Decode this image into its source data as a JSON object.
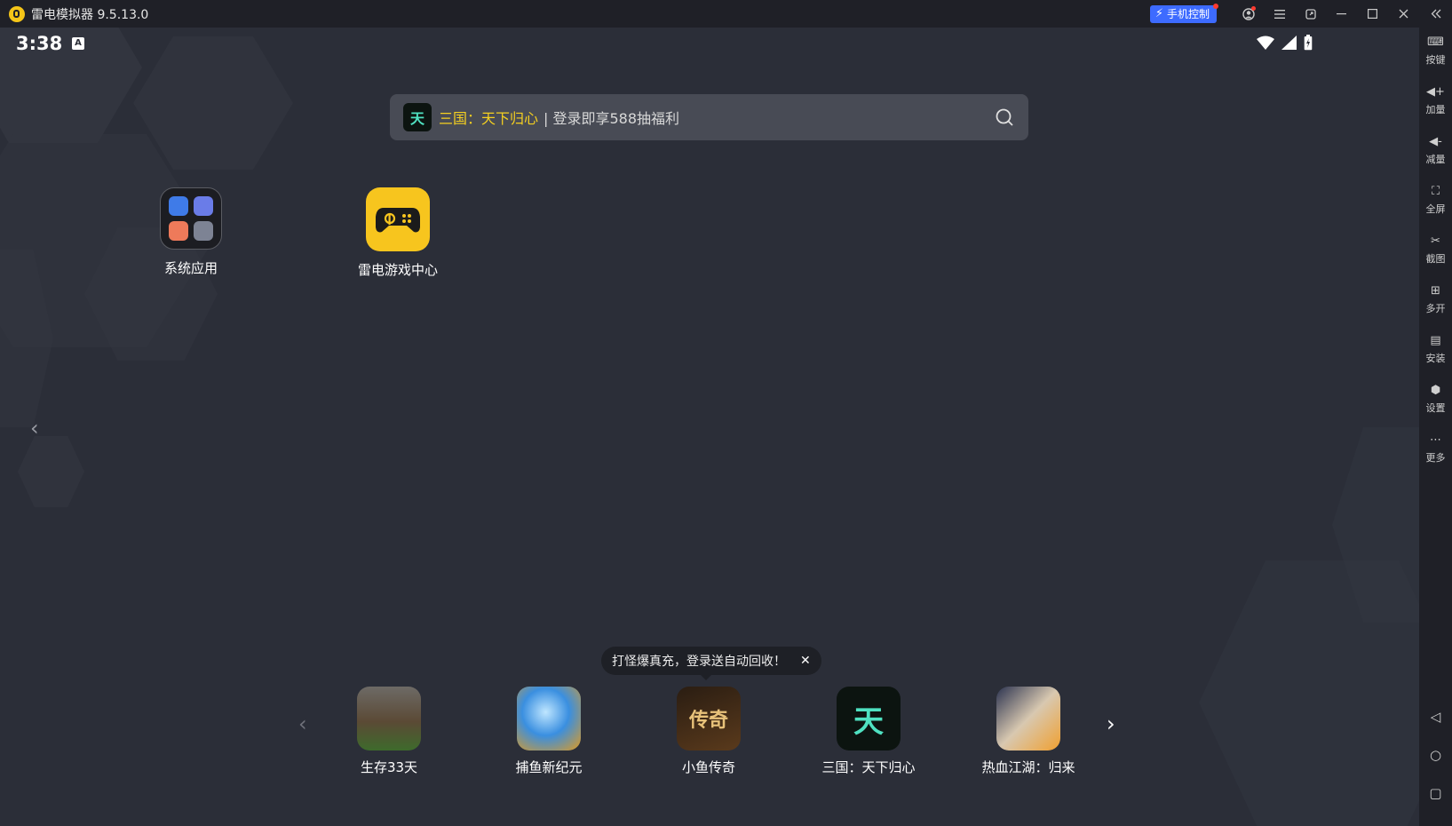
{
  "titlebar": {
    "app_title": "雷电模拟器 9.5.13.0",
    "phone_control_label": "手机控制",
    "icons": [
      "user-icon",
      "menu-icon",
      "restore-window-icon",
      "minimize-icon",
      "maximize-icon",
      "close-icon",
      "collapse-sidebar-icon"
    ]
  },
  "status": {
    "time": "3:38",
    "notification_glyph": "A"
  },
  "search": {
    "highlight": "三国：天下归心",
    "rest": "| 登录即享588抽福利",
    "thumb_glyph": "天"
  },
  "desktop": {
    "items": [
      {
        "label": "系统应用"
      },
      {
        "label": "雷电游戏中心"
      }
    ]
  },
  "tooltip": {
    "text": "打怪爆真充，登录送自动回收！",
    "close_glyph": "✕"
  },
  "dock": {
    "prev_glyph": "‹",
    "next_glyph": "›",
    "items": [
      {
        "label": "生存33天",
        "glyph": "",
        "color": "#7a6a4a"
      },
      {
        "label": "捕鱼新纪元",
        "glyph": "",
        "color": "#3a8fe0"
      },
      {
        "label": "小鱼传奇",
        "glyph": "传奇",
        "color": "#3b2a1a"
      },
      {
        "label": "三国：天下归心",
        "glyph": "天",
        "color": "#0c1410"
      },
      {
        "label": "热血江湖：归来",
        "glyph": "",
        "color": "#d8c8b0"
      }
    ]
  },
  "sidebar": {
    "items": [
      {
        "label": "按键",
        "icon": "keyboard-icon"
      },
      {
        "label": "加量",
        "icon": "volume-up-icon"
      },
      {
        "label": "减量",
        "icon": "volume-down-icon"
      },
      {
        "label": "全屏",
        "icon": "fullscreen-icon"
      },
      {
        "label": "截图",
        "icon": "screenshot-icon"
      },
      {
        "label": "多开",
        "icon": "multi-instance-icon"
      },
      {
        "label": "安装",
        "icon": "install-icon"
      },
      {
        "label": "设置",
        "icon": "settings-icon"
      },
      {
        "label": "更多",
        "icon": "more-icon"
      }
    ],
    "nav": [
      "back-icon",
      "home-icon",
      "recents-icon"
    ]
  },
  "colors": {
    "accent_blue": "#3d6bff",
    "brand_yellow": "#f7c51e",
    "highlight_yellow": "#f5d020"
  }
}
